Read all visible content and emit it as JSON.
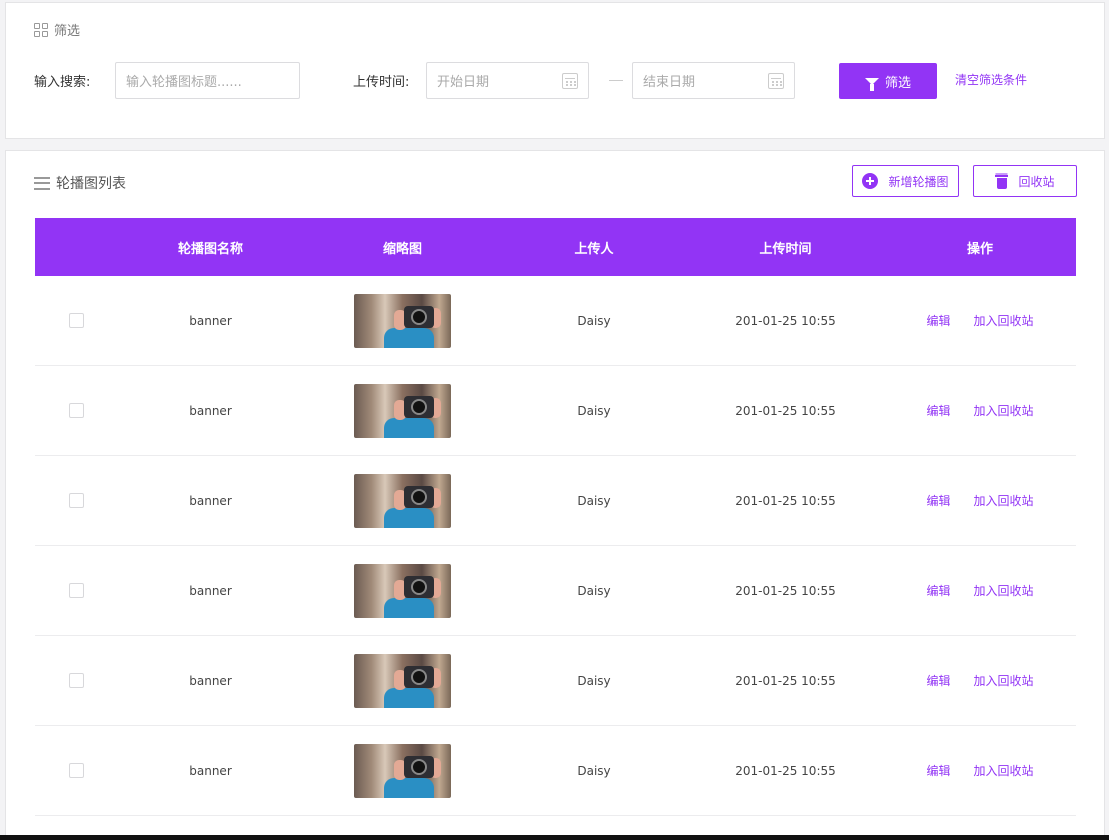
{
  "filter": {
    "title": "筛选",
    "search_label": "输入搜索:",
    "search_placeholder": "输入轮播图标题......",
    "time_label": "上传时间:",
    "start_placeholder": "开始日期",
    "end_placeholder": "结束日期",
    "filter_button": "筛选",
    "clear_link": "清空筛选条件"
  },
  "list": {
    "title": "轮播图列表",
    "add_button": "新增轮播图",
    "recycle_button": "回收站",
    "columns": [
      "轮播图名称",
      "缩略图",
      "上传人",
      "上传时间",
      "操作"
    ],
    "rows": [
      {
        "name": "banner",
        "uploader": "Daisy",
        "time": "201-01-25 10:55",
        "edit": "编辑",
        "recycle": "加入回收站"
      },
      {
        "name": "banner",
        "uploader": "Daisy",
        "time": "201-01-25 10:55",
        "edit": "编辑",
        "recycle": "加入回收站"
      },
      {
        "name": "banner",
        "uploader": "Daisy",
        "time": "201-01-25 10:55",
        "edit": "编辑",
        "recycle": "加入回收站"
      },
      {
        "name": "banner",
        "uploader": "Daisy",
        "time": "201-01-25 10:55",
        "edit": "编辑",
        "recycle": "加入回收站"
      },
      {
        "name": "banner",
        "uploader": "Daisy",
        "time": "201-01-25 10:55",
        "edit": "编辑",
        "recycle": "加入回收站"
      },
      {
        "name": "banner",
        "uploader": "Daisy",
        "time": "201-01-25 10:55",
        "edit": "编辑",
        "recycle": "加入回收站"
      }
    ]
  },
  "colors": {
    "accent": "#9234f5"
  },
  "icons": [
    "grid-icon",
    "calendar-icon",
    "filter-icon",
    "list-icon",
    "plus-circle-icon",
    "trash-icon",
    "photo-thumbnail"
  ]
}
